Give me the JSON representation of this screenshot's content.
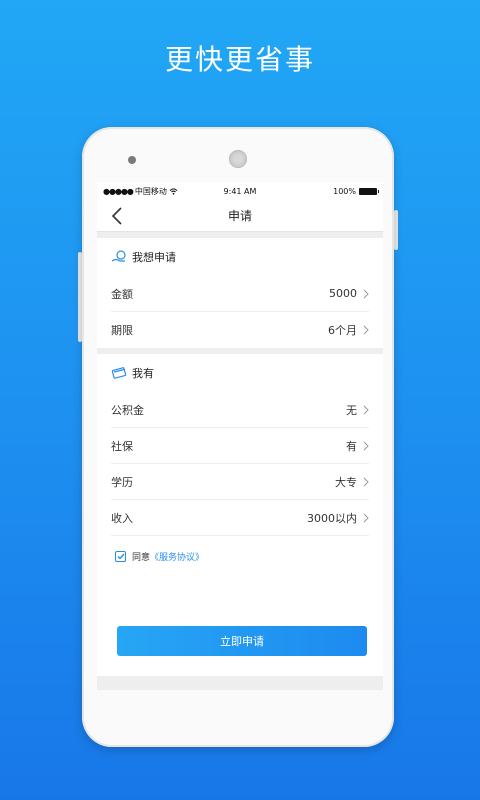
{
  "headline": "更快更省事",
  "status_bar": {
    "signal": "●●●●●",
    "carrier": "中国移动",
    "time": "9:41 AM",
    "battery": "100%"
  },
  "nav": {
    "title": "申请"
  },
  "apply_section": {
    "title": "我想申请",
    "rows": [
      {
        "label": "金额",
        "value": "5000"
      },
      {
        "label": "期限",
        "value": "6个月"
      }
    ]
  },
  "have_section": {
    "title": "我有",
    "rows": [
      {
        "label": "公积金",
        "value": "无"
      },
      {
        "label": "社保",
        "value": "有"
      },
      {
        "label": "学历",
        "value": "大专"
      },
      {
        "label": "收入",
        "value": "3000以内"
      }
    ]
  },
  "agreement": {
    "checked": true,
    "prefix": "同意",
    "link": "《服务协议》"
  },
  "submit_label": "立即申请",
  "colors": {
    "accent": "#1d8aef",
    "background": "#1d8ff0"
  }
}
